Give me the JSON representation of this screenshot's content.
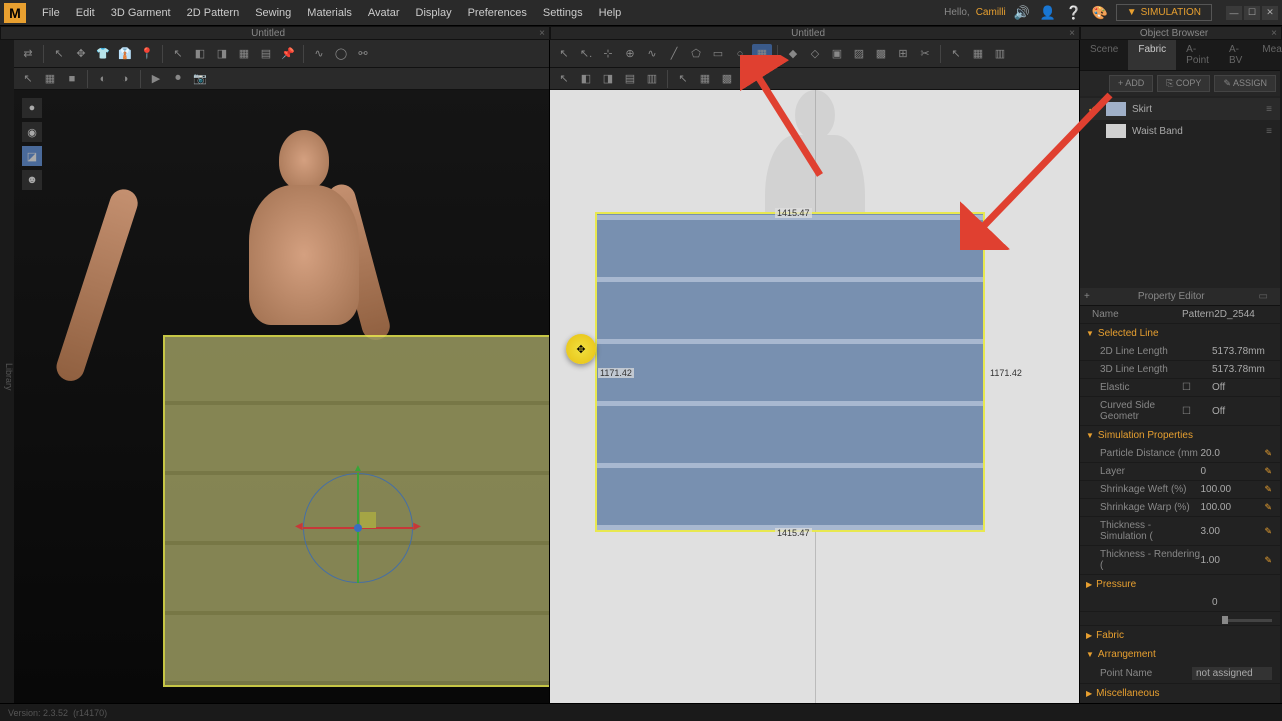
{
  "logo": "M",
  "menu": [
    "File",
    "Edit",
    "3D Garment",
    "2D Pattern",
    "Sewing",
    "Materials",
    "Avatar",
    "Display",
    "Preferences",
    "Settings",
    "Help"
  ],
  "hello": "Hello,",
  "username": "Camilli",
  "sim_button": "SIMULATION",
  "titles": {
    "left": "Untitled",
    "right": "Untitled",
    "browser": "Object Browser"
  },
  "browser_tabs": [
    "Scene",
    "Fabric",
    "A-Point",
    "A-BV",
    "Measure"
  ],
  "browser_actions": {
    "add": "+ ADD",
    "copy": "⎘ COPY",
    "assign": "✎ ASSIGN"
  },
  "fabrics": [
    {
      "name": "Skirt",
      "color": "#a0b0c8",
      "active": true
    },
    {
      "name": "Waist Band",
      "color": "#d0d0d0",
      "active": false
    }
  ],
  "pattern_dims": {
    "width": "1415.47",
    "height": "1171.42"
  },
  "prop_editor": {
    "title": "Property Editor",
    "name_label": "Name",
    "name_value": "Pattern2D_2544",
    "sections": {
      "selected_line": "Selected Line",
      "sim_props": "Simulation Properties",
      "pressure": "Pressure",
      "fabric": "Fabric",
      "arrangement": "Arrangement",
      "misc": "Miscellaneous"
    },
    "rows": {
      "line_2d": {
        "label": "2D Line Length",
        "value": "5173.78mm"
      },
      "line_3d": {
        "label": "3D Line Length",
        "value": "5173.78mm"
      },
      "elastic": {
        "label": "Elastic",
        "value": "Off"
      },
      "curved": {
        "label": "Curved Side Geometr",
        "value": "Off"
      },
      "particle": {
        "label": "Particle Distance (mm",
        "value": "20.0"
      },
      "layer": {
        "label": "Layer",
        "value": "0"
      },
      "shrink_weft": {
        "label": "Shrinkage Weft (%)",
        "value": "100.00"
      },
      "shrink_warp": {
        "label": "Shrinkage Warp (%)",
        "value": "100.00"
      },
      "thick_sim": {
        "label": "Thickness - Simulation (",
        "value": "3.00"
      },
      "thick_rend": {
        "label": "Thickness - Rendering (",
        "value": "1.00"
      },
      "pressure_val": {
        "label": "",
        "value": "0"
      },
      "point_name": {
        "label": "Point Name",
        "value": "not assigned"
      }
    }
  },
  "status": {
    "version": "Version: 2.3.52",
    "build": "(r14170)"
  }
}
